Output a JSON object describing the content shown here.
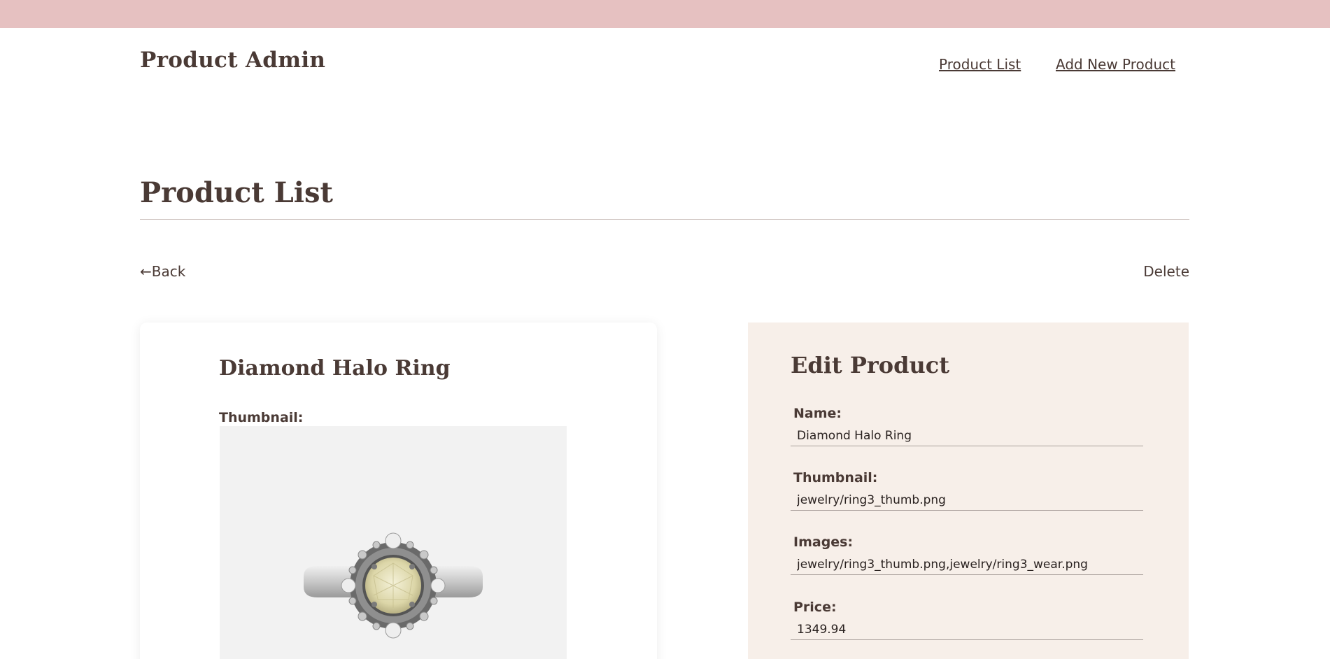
{
  "header": {
    "brand": "Product Admin",
    "nav": [
      {
        "label": "Product List"
      },
      {
        "label": "Add New Product"
      }
    ]
  },
  "page": {
    "title": "Product List",
    "back_label": "←Back",
    "delete_label": "Delete"
  },
  "product_card": {
    "title": "Diamond Halo Ring",
    "thumbnail_label": "Thumbnail:"
  },
  "edit_form": {
    "title": "Edit Product",
    "fields": [
      {
        "label": "Name:",
        "value": "Diamond Halo Ring"
      },
      {
        "label": "Thumbnail:",
        "value": "jewelry/ring3_thumb.png"
      },
      {
        "label": "Images:",
        "value": "jewelry/ring3_thumb.png,jewelry/ring3_wear.png"
      },
      {
        "label": "Price:",
        "value": "1349.94"
      }
    ]
  },
  "colors": {
    "topbar": "#e6c1c1",
    "text": "#4a3a35",
    "panel": "#f7efe9"
  }
}
